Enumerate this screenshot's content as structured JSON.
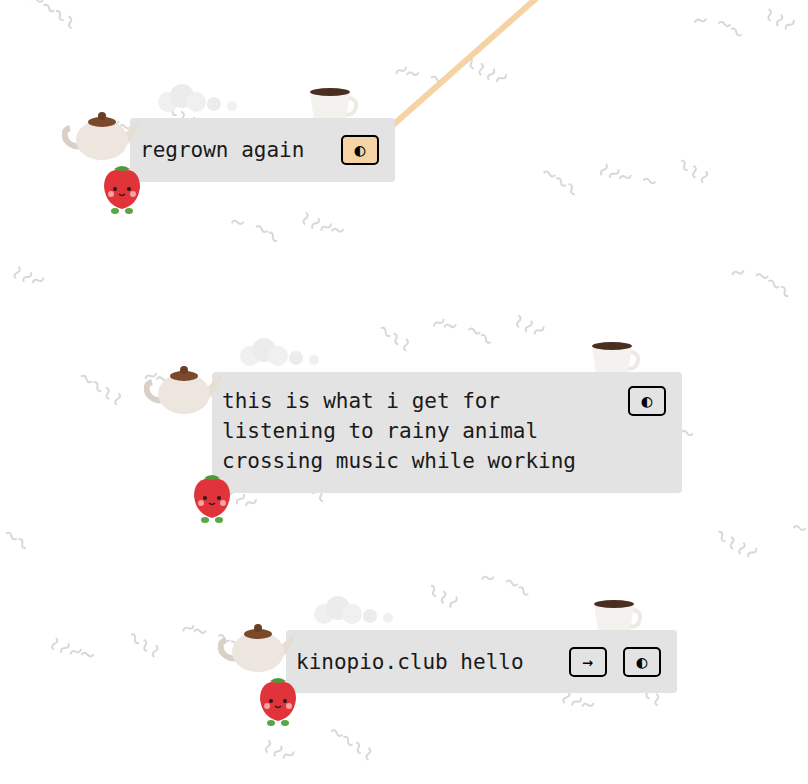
{
  "cards": [
    {
      "name": "regrown again",
      "buttons": [
        {
          "label": "◐",
          "selected": true
        }
      ]
    },
    {
      "name": "this is what i get for listening to rainy animal crossing music while working",
      "buttons": [
        {
          "label": "◐",
          "selected": false
        }
      ]
    },
    {
      "name": "kinopio.club hello",
      "buttons": [
        {
          "label": "→",
          "selected": false
        },
        {
          "label": "◐",
          "selected": false
        }
      ]
    }
  ]
}
